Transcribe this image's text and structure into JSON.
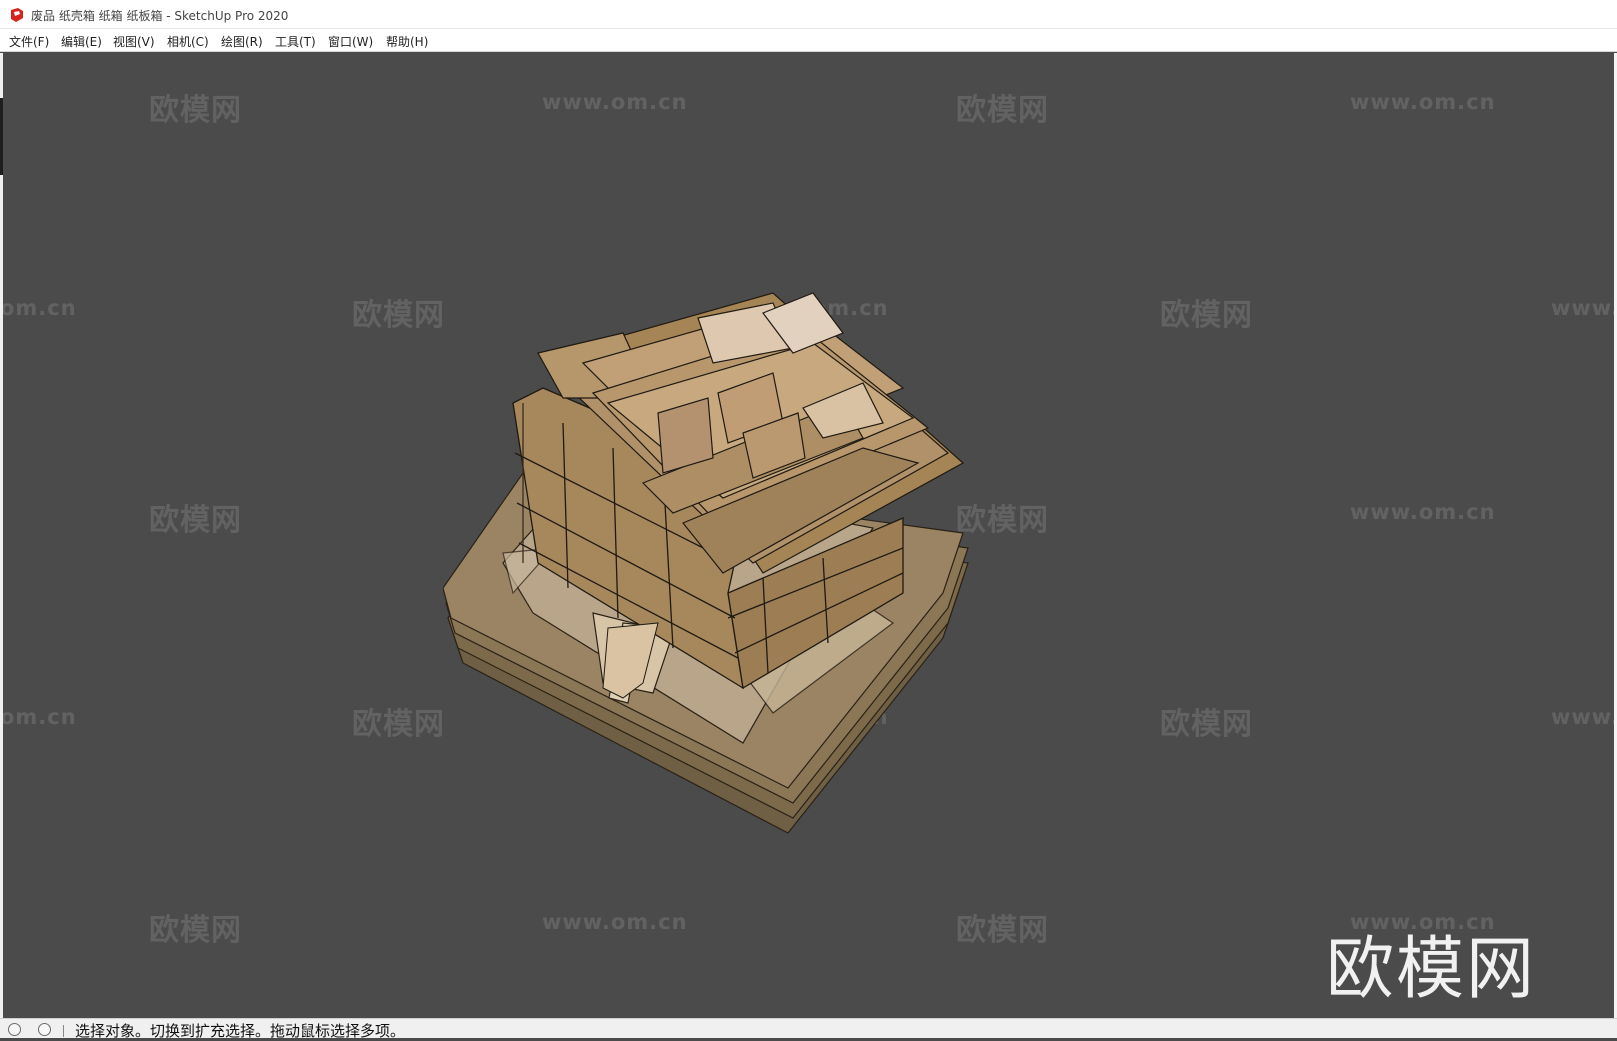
{
  "window": {
    "title": "废品 纸壳箱 纸箱 纸板箱 - SketchUp Pro 2020",
    "app_icon": "sketchup-icon"
  },
  "menu": {
    "items": [
      "文件(F)",
      "编辑(E)",
      "视图(V)",
      "相机(C)",
      "绘图(R)",
      "工具(T)",
      "窗口(W)",
      "帮助(H)"
    ]
  },
  "watermarks": {
    "logo_text": "欧模网",
    "url_text": "www.om.cn",
    "url_partial_left": "om.cn",
    "url_partial_right": "www."
  },
  "viewport": {
    "background": "#4b4b4b",
    "model_description_icon": "cardboard-stack-model"
  },
  "statusbar": {
    "icons": [
      "geolocation-icon",
      "info-icon"
    ],
    "hint": "选择对象。切换到扩充选择。拖动鼠标选择多项。"
  }
}
